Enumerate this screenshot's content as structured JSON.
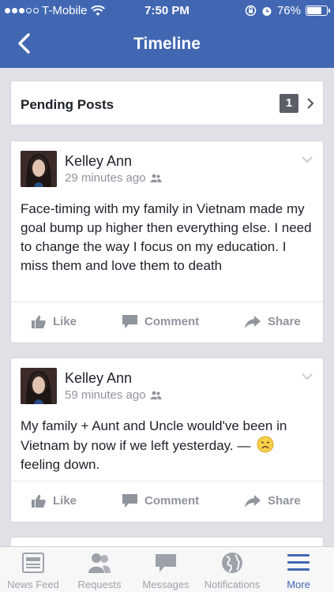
{
  "status_bar": {
    "carrier": "T-Mobile",
    "time": "7:50 PM",
    "battery_text": "76%",
    "battery_level": 0.76
  },
  "nav": {
    "title": "Timeline",
    "back_icon": "chevron-left-icon"
  },
  "pending": {
    "label": "Pending Posts",
    "count": "1"
  },
  "posts": [
    {
      "author": "Kelley Ann",
      "time": "29 minutes ago",
      "text": "Face-timing with my family in Vietnam made my goal bump up higher then everything else. I need to change the way I focus on my education. I miss them and love them to death"
    },
    {
      "author": "Kelley Ann",
      "time": "59 minutes ago",
      "text": "My family + Aunt and Uncle would've been in Vietnam by now if we left yesterday. — ",
      "feeling": "feeling down."
    }
  ],
  "actions": {
    "like": "Like",
    "comment": "Comment",
    "share": "Share"
  },
  "tabs": [
    {
      "label": "News Feed",
      "icon": "news-feed-icon"
    },
    {
      "label": "Requests",
      "icon": "friend-requests-icon"
    },
    {
      "label": "Messages",
      "icon": "messages-icon"
    },
    {
      "label": "Notifications",
      "icon": "globe-icon"
    },
    {
      "label": "More",
      "icon": "menu-icon"
    }
  ],
  "colors": {
    "brand": "#4267b2",
    "background": "#dfe1e6",
    "muted": "#90949c",
    "active_tab": "#4267b2"
  }
}
